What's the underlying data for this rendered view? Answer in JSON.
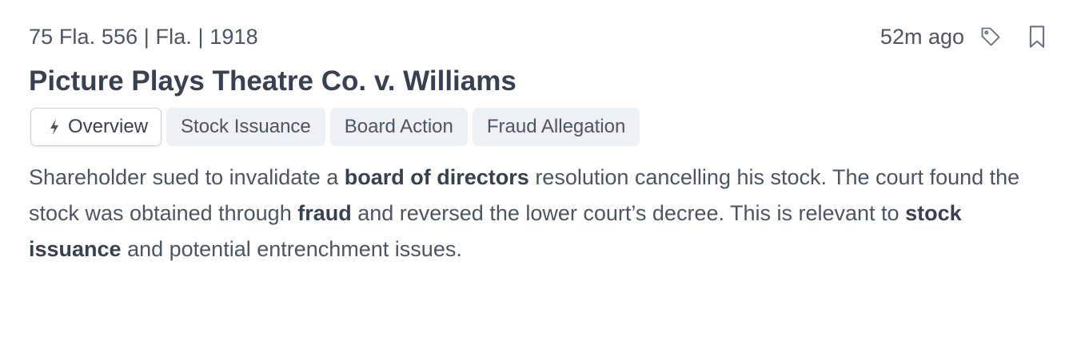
{
  "meta": {
    "citation": "75 Fla. 556 | Fla. | 1918",
    "time_ago": "52m ago",
    "tag_icon": "tag-icon",
    "bookmark_icon": "bookmark-icon"
  },
  "case": {
    "title": "Picture Plays Theatre Co. v. Williams"
  },
  "tabs": [
    {
      "label": "Overview",
      "icon": "bolt-icon",
      "active": true
    },
    {
      "label": "Stock Issuance",
      "active": false
    },
    {
      "label": "Board Action",
      "active": false
    },
    {
      "label": "Fraud Allegation",
      "active": false
    }
  ],
  "summary": {
    "part1": "Shareholder sued to invalidate a ",
    "bold1": "board of directors",
    "part2": " resolution cancelling his stock. The court found the stock was obtained through ",
    "bold2": "fraud",
    "part3": " and reversed the lower court’s decree. This is relevant to ",
    "bold3": "stock issuance",
    "part4": " and potential entrenchment issues."
  },
  "colors": {
    "text": "#4b5563",
    "heading": "#374151",
    "tab_bg": "#eef0f3",
    "active_tab_border": "#cfd3d9"
  }
}
